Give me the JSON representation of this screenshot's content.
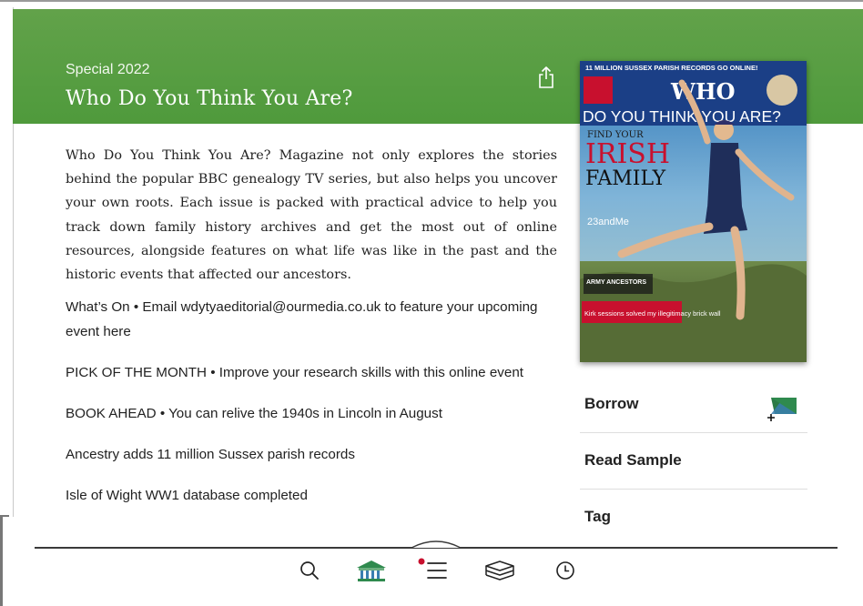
{
  "header": {
    "subtitle": "Special 2022",
    "title": "Who Do You Think You Are?",
    "color": "#559d3f"
  },
  "description": "Who Do You Think You Are? Magazine not only explores the stories behind the popular BBC genealogy TV series, but also helps you uncover your own roots. Each issue is packed with practical advice to help you track down family history archives and get the most out of online resources, alongside features on what life was like in the past and the historic events that affected our ancestors.",
  "articles": [
    "What’s On • Email wdytyaeditorial@ourmedia.co.uk to feature your upcoming event here",
    "PICK OF THE MONTH • Improve your research skills with this online event",
    "BOOK AHEAD • You can relive the 1940s in Lincoln in August",
    "Ancestry adds 11 million Sussex parish records",
    "Isle of Wight WW1 database completed"
  ],
  "cover": {
    "banner": "11 MILLION SUSSEX PARISH RECORDS GO ONLINE!",
    "masthead": "WHO",
    "title_line": "DO YOU THINK YOU ARE?",
    "find_your": "FIND YOUR",
    "irish": "IRISH",
    "family": "FAMILY",
    "dna": "23andMe",
    "army": "ARMY ANCESTORS",
    "kirk": "Kirk sessions solved my illegitimacy brick wall"
  },
  "actions": {
    "borrow": "Borrow",
    "read_sample": "Read Sample",
    "tag": "Tag"
  },
  "tabs": {
    "search": "search-icon",
    "library": "library-icon",
    "menu": "menu-list-icon",
    "stack": "book-stack-icon",
    "recent": "clock-icon",
    "badge_color": "#c8102e"
  }
}
